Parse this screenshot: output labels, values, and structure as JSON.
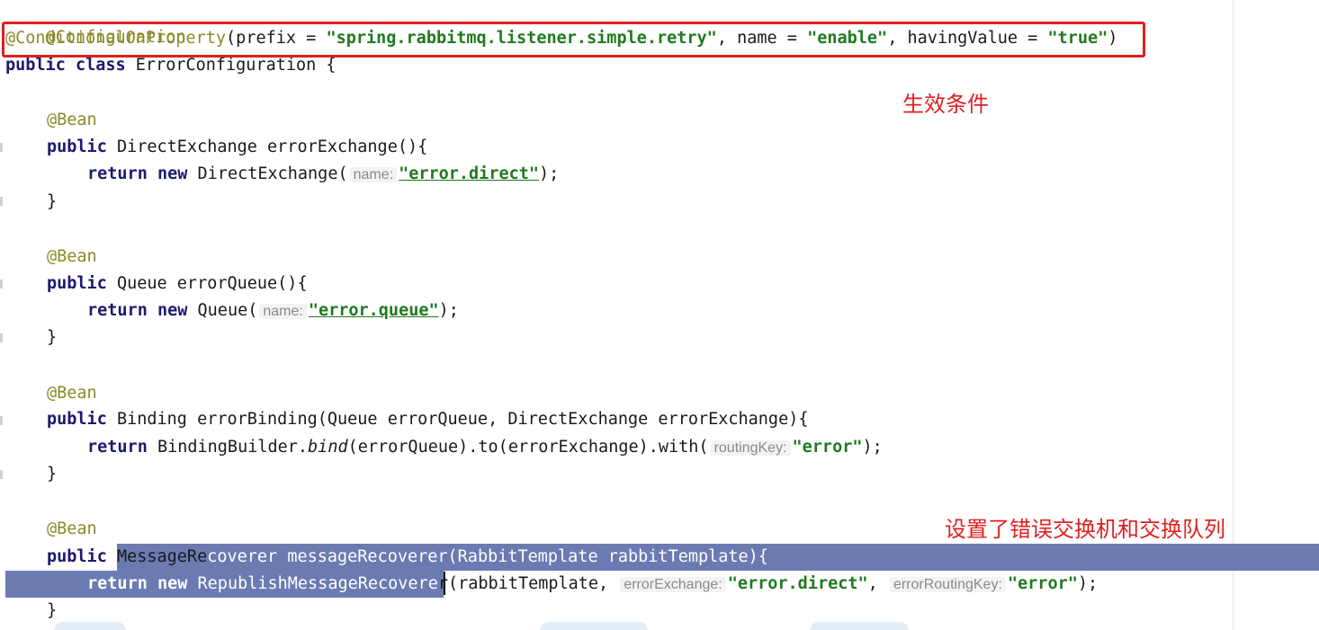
{
  "code": {
    "l01": {
      "ann": "@Configuration"
    },
    "l02": {
      "ann": "@ConditionalOnProperty",
      "p1": "(prefix = ",
      "s1": "\"spring.rabbitmq.listener.simple.retry\"",
      "p2": ", name = ",
      "s2": "\"enable\"",
      "p3": ", havingValue = ",
      "s3": "\"true\"",
      "p4": ")"
    },
    "l03": {
      "kw": "public class",
      "rest": " ErrorConfiguration {"
    },
    "l05": {
      "ann": "@Bean"
    },
    "l06": {
      "kw": "public",
      "rest": " DirectExchange errorExchange(){"
    },
    "l07": {
      "kw": "return new",
      "p1": " DirectExchange(",
      "hint": "name:",
      "s1": "\"error.direct\"",
      "p2": ");"
    },
    "l08": {
      "text": "}"
    },
    "l10": {
      "ann": "@Bean"
    },
    "l11": {
      "kw": "public",
      "rest": " Queue errorQueue(){"
    },
    "l12": {
      "kw": "return new",
      "p1": " Queue(",
      "hint": "name:",
      "s1": "\"error.queue\"",
      "p2": ");"
    },
    "l13": {
      "text": "}"
    },
    "l15": {
      "ann": "@Bean"
    },
    "l16": {
      "kw": "public",
      "rest": " Binding errorBinding(Queue errorQueue, DirectExchange errorExchange){"
    },
    "l17": {
      "kw": "return",
      "p1": " BindingBuilder.",
      "it": "bind",
      "p2": "(errorQueue).to(errorExchange).with(",
      "hint": "routingKey:",
      "s1": "\"error\"",
      "p3": ");"
    },
    "l18": {
      "text": "}"
    },
    "l20": {
      "ann": "@Bean"
    },
    "l21": {
      "kw": "public",
      "p1": " MessageRe",
      "p2": "coverer messageRecoverer(RabbitTemplate rabbitTemplate){"
    },
    "l22": {
      "kw": "return new",
      "p1": " RepublishMessageRecovere",
      "p2": "r(rabbitTemplate, ",
      "hint1": "errorExchange:",
      "s1": "\"error.direct\"",
      "p3": ", ",
      "hint2": "errorRoutingKey:",
      "s2": "\"error\"",
      "p4": ");"
    },
    "l23": {
      "text": "}"
    }
  },
  "annotations": {
    "condition_note": "生效条件",
    "setup_note": "设置了错误交换机和交换队列"
  },
  "colors": {
    "highlight_box": "#e01e1e",
    "note_text": "#e02020",
    "selection": "#6b7bb2"
  }
}
